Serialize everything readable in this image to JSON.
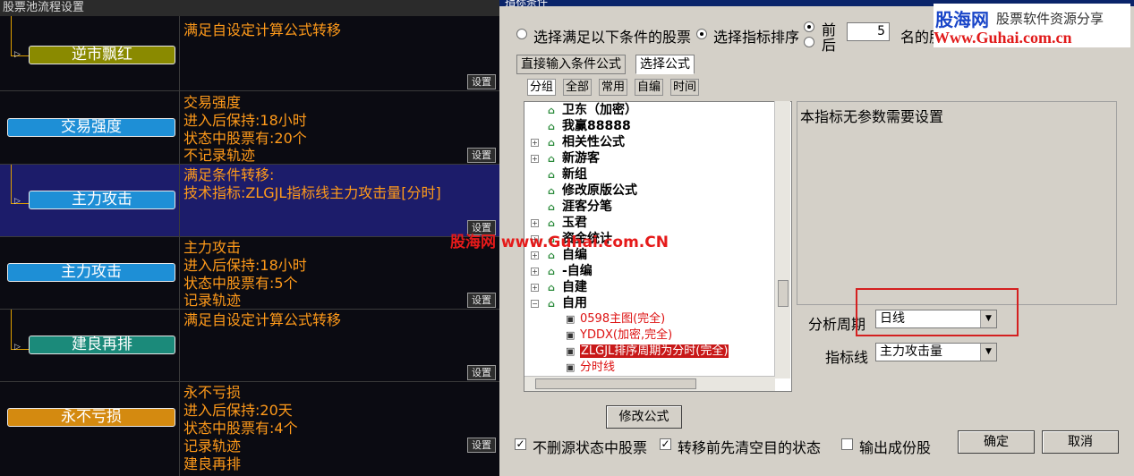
{
  "left_panel": {
    "title": "股票池流程设置",
    "set_label": "设置",
    "rows": [
      {
        "node": "逆市飘红",
        "desc": [
          "满足自设定计算公式转移"
        ]
      },
      {
        "node": "交易强度",
        "desc": [
          "交易强度",
          "进入后保持:18小时",
          "状态中股票有:20个",
          "不记录轨迹"
        ]
      },
      {
        "node": "主力攻击",
        "desc": [
          "满足条件转移:",
          "技术指标:ZLGJL指标线主力攻击量[分时]"
        ]
      },
      {
        "node": "主力攻击",
        "desc": [
          "主力攻击",
          "进入后保持:18小时",
          "状态中股票有:5个",
          "记录轨迹"
        ]
      },
      {
        "node": "建良再排",
        "desc": [
          "满足自设定计算公式转移"
        ]
      },
      {
        "node": "永不亏损",
        "desc": [
          "永不亏损",
          "进入后保持:20天",
          "状态中股票有:4个",
          "记录轨迹",
          "建良再排"
        ]
      }
    ],
    "colors": {
      "olive": "#8a8a00",
      "blue": "#1e8fd6",
      "teal": "#1b8a7a",
      "orange": "#d48a10",
      "text": "#ff9a1a"
    }
  },
  "dialog": {
    "title": "指标条件",
    "radio_condition": "选择满足以下条件的股票",
    "radio_rank": "选择指标排序",
    "front": "前",
    "back": "后",
    "rank_count": "5",
    "rank_suffix": "名的股",
    "tab_direct": "直接输入条件公式",
    "tab_select": "选择公式",
    "subtabs": [
      "分组",
      "全部",
      "常用",
      "自编",
      "时间"
    ],
    "tree": [
      "卫东（加密）",
      "我赢88888",
      "相关性公式",
      "新游客",
      "新组",
      "修改原版公式",
      "涯客分笔",
      "玉君",
      "资金统计",
      "自编",
      "-自编",
      "自建",
      "自用"
    ],
    "tree_children": [
      "0598主图(完全)",
      "YDDX(加密,完全)",
      "ZLGJL排序周期为分时(完全)",
      "分时线"
    ],
    "info": "本指标无参数需要设置",
    "period_label": "分析周期",
    "period_value": "日线",
    "line_label": "指标线",
    "line_value": "主力攻击量",
    "modify_btn": "修改公式",
    "chk_keep": "不删源状态中股票",
    "chk_clear": "转移前先清空目的状态",
    "chk_output": "输出成份股",
    "ok": "确定",
    "cancel": "取消"
  },
  "watermarks": {
    "center": "股海网 www.Guhai.com.CN",
    "logo_main": "股海网",
    "logo_sub": "股票软件资源分享",
    "logo_url": "Www.Guhai.com.cn"
  }
}
